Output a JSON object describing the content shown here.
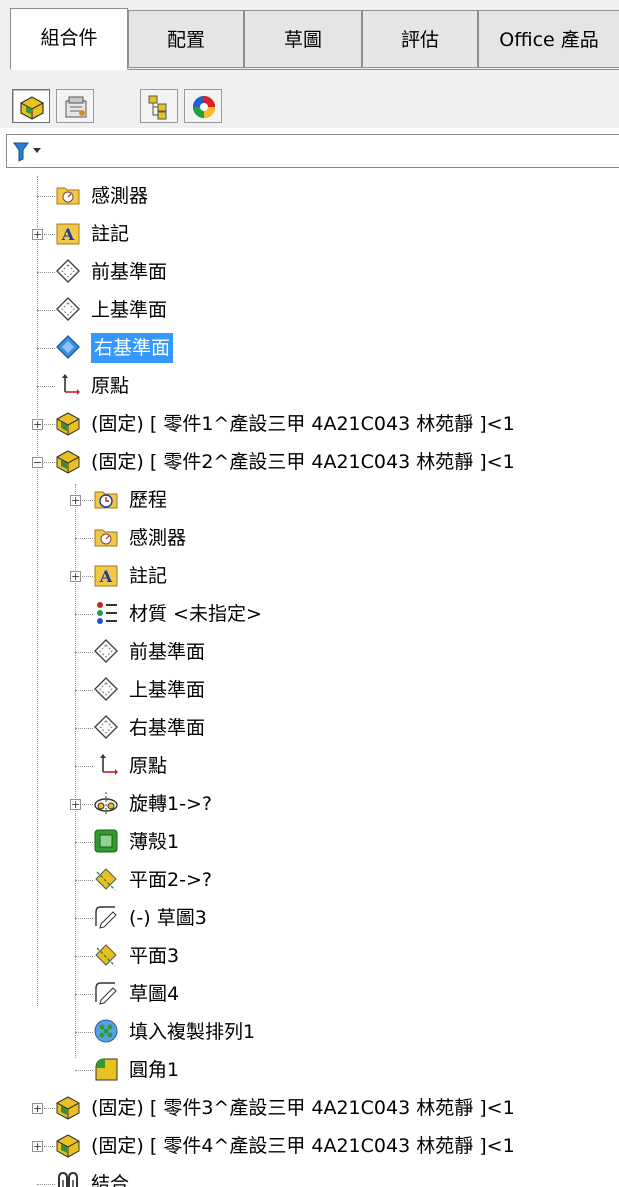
{
  "tabs": [
    {
      "label": "組合件",
      "active": true
    },
    {
      "label": "配置"
    },
    {
      "label": "草圖"
    },
    {
      "label": "評估"
    },
    {
      "label": "Office 產品"
    }
  ],
  "toolbar": {
    "buttons": [
      {
        "name": "featuremanager-tree-icon"
      },
      {
        "name": "propertymanager-icon"
      },
      {
        "name": "configurationmanager-icon"
      },
      {
        "name": "displaymanager-icon"
      }
    ]
  },
  "filter": {
    "icon": "filter-icon",
    "dropdown": "chevron-down-icon"
  },
  "tree": {
    "sensors": "感測器",
    "annotations": "註記",
    "front_plane": "前基準面",
    "top_plane": "上基準面",
    "right_plane": "右基準面",
    "origin": "原點",
    "part1": "(固定) [ 零件1^產設三甲 4A21C043 林苑靜 ]<1",
    "part2": "(固定) [ 零件2^產設三甲 4A21C043 林苑靜 ]<1",
    "part2_children": {
      "history": "歷程",
      "sensors": "感測器",
      "annotations": "註記",
      "material": "材質 <未指定>",
      "front_plane": "前基準面",
      "top_plane": "上基準面",
      "right_plane": "右基準面",
      "origin": "原點",
      "revolve": "旋轉1->?",
      "shell": "薄殼1",
      "plane2": "平面2->?",
      "sketch3": "(-) 草圖3",
      "plane3": "平面3",
      "sketch4": "草圖4",
      "fill_pattern": "填入複製排列1",
      "fillet": "圓角1"
    },
    "part3": "(固定) [ 零件3^產設三甲 4A21C043 林苑靜 ]<1",
    "part4": "(固定) [ 零件4^產設三甲 4A21C043 林苑靜 ]<1",
    "mates": "結合"
  },
  "colors": {
    "selection": "#3399ff",
    "folder": "#f2c84b",
    "part": "#e8c020"
  }
}
